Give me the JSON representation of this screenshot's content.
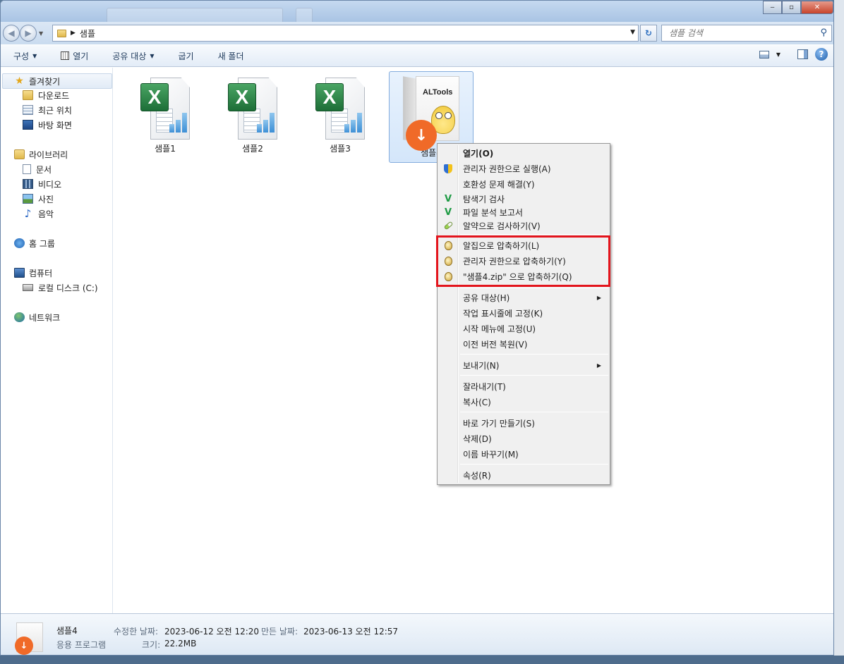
{
  "titlebar": {
    "minimize": "‒",
    "maximize": "▫",
    "close": "✕"
  },
  "navigation": {
    "path_folder": "샘플",
    "search_placeholder": "샘플 검색"
  },
  "toolbar": {
    "organize": "구성",
    "open": "열기",
    "share": "공유 대상",
    "burn": "굽기",
    "new_folder": "새 폴더"
  },
  "sidebar": {
    "favorites": {
      "label": "즐겨찾기",
      "items": [
        "다운로드",
        "최근 위치",
        "바탕 화면"
      ]
    },
    "libraries": {
      "label": "라이브러리",
      "items": [
        "문서",
        "비디오",
        "사진",
        "음악"
      ]
    },
    "homegroup": "홈 그룹",
    "computer": {
      "label": "컴퓨터",
      "items": [
        "로컬 디스크 (C:)"
      ]
    },
    "network": "네트워크"
  },
  "files": [
    {
      "name": "샘플1",
      "icon": "excel-icon"
    },
    {
      "name": "샘플2",
      "icon": "excel-icon"
    },
    {
      "name": "샘플3",
      "icon": "excel-icon"
    },
    {
      "name": "샘플4",
      "icon": "altools-installer-icon",
      "icon_title": "ALTools",
      "selected": true
    }
  ],
  "context_menu": {
    "items": [
      {
        "label": "열기(O)",
        "bold": true
      },
      {
        "label": "관리자 권한으로 실행(A)",
        "icon": "uac-shield-icon"
      },
      {
        "label": "호환성 문제 해결(Y)"
      },
      {
        "label": "탐색기 검사",
        "icon": "v3-icon"
      },
      {
        "label": "파일 분석 보고서",
        "icon": "v3-icon"
      },
      {
        "label": "알약으로 검사하기(V)",
        "icon": "alyac-pill-icon"
      },
      {
        "label": "알집으로 압축하기(L)",
        "icon": "alzip-egg-icon"
      },
      {
        "label": "관리자 권한으로 압축하기(Y)",
        "icon": "alzip-egg-icon"
      },
      {
        "label": "\"샘플4.zip\" 으로 압축하기(Q)",
        "icon": "alzip-egg-icon"
      },
      {
        "label": "공유 대상(H)",
        "submenu": true
      },
      {
        "label": "작업 표시줄에 고정(K)"
      },
      {
        "label": "시작 메뉴에 고정(U)"
      },
      {
        "label": "이전 버전 복원(V)"
      },
      {
        "label": "보내기(N)",
        "submenu": true
      },
      {
        "label": "잘라내기(T)"
      },
      {
        "label": "복사(C)"
      },
      {
        "label": "바로 가기 만들기(S)"
      },
      {
        "label": "삭제(D)"
      },
      {
        "label": "이름 바꾸기(M)"
      },
      {
        "label": "속성(R)"
      }
    ],
    "highlight_color": "#e3141c"
  },
  "details": {
    "name": "샘플4",
    "type": "응용 프로그램",
    "modified_label": "수정한 날짜:",
    "modified_value": "2023-06-12 오전 12:20",
    "created_label": "만든 날짜:",
    "created_value": "2023-06-13 오전 12:57",
    "size_label": "크기:",
    "size_value": "22.2MB"
  }
}
